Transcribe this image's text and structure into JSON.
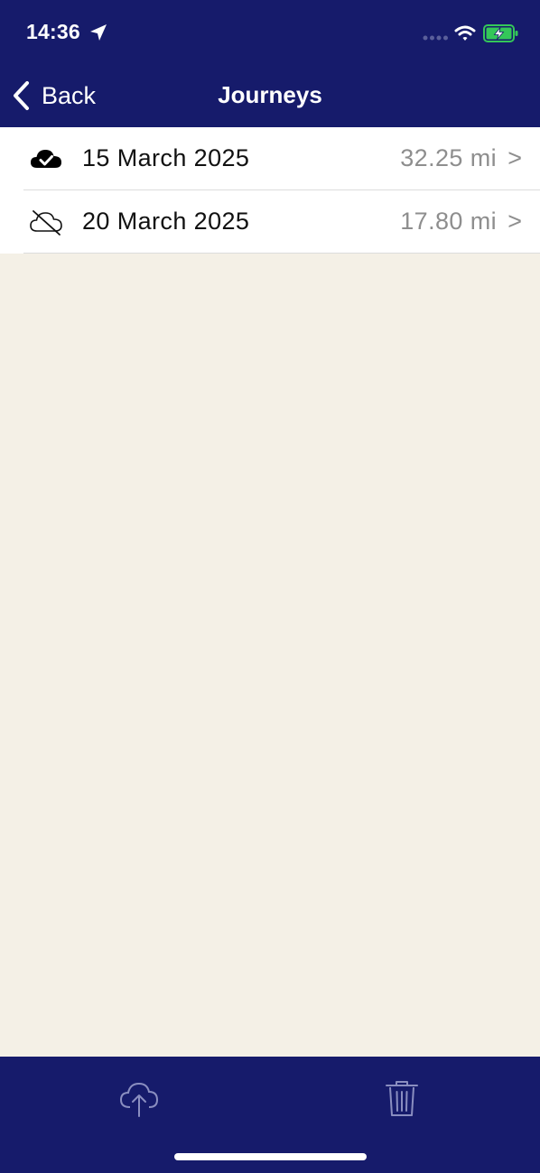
{
  "status_bar": {
    "time": "14:36",
    "icons": [
      "location-arrow-icon",
      "signal-dots-icon",
      "wifi-icon",
      "battery-charging-icon"
    ]
  },
  "nav": {
    "back_label": "Back",
    "title": "Journeys"
  },
  "journeys": [
    {
      "date": "15 March 2025",
      "distance": "32.25 mi",
      "chevron": ">",
      "icon": "cloud-check-icon"
    },
    {
      "date": "20 March 2025",
      "distance": "17.80 mi",
      "chevron": ">",
      "icon": "cloud-slash-icon"
    }
  ],
  "toolbar": {
    "upload_icon": "cloud-upload-icon",
    "trash_icon": "trash-icon"
  },
  "colors": {
    "nav_background": "#161b6b",
    "page_background": "#f4f0e6",
    "list_background": "#ffffff",
    "secondary_text": "#8e8e8e",
    "battery_fill": "#34c759"
  }
}
